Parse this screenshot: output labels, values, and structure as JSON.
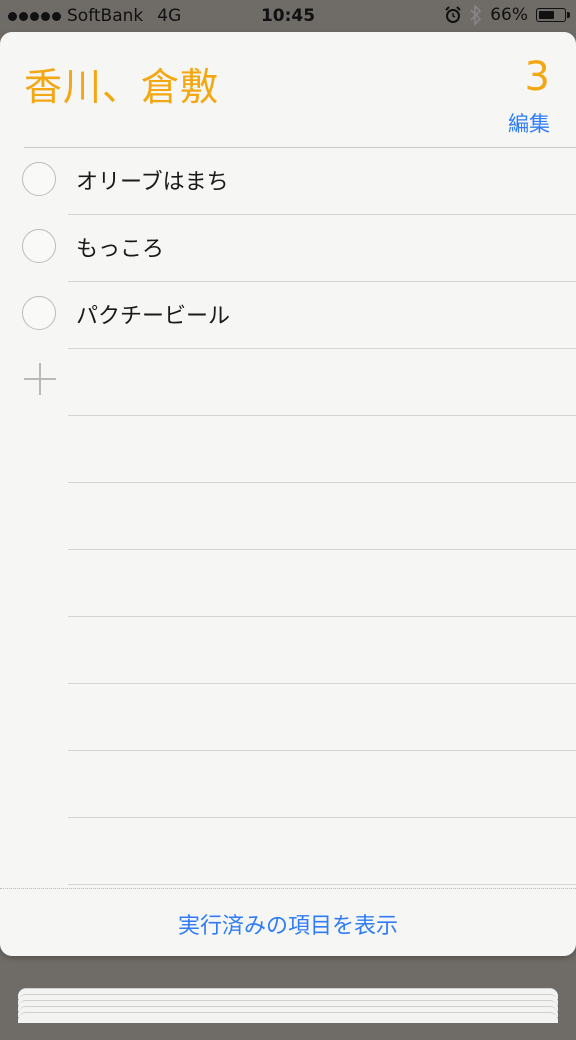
{
  "status_bar": {
    "carrier": "SoftBank",
    "network": "4G",
    "time": "10:45",
    "alarm_icon": "alarm-icon",
    "bluetooth_icon": "bluetooth-icon",
    "battery": "66%",
    "battery_level": 0.66
  },
  "list": {
    "title": "香川、倉敷",
    "count": "3",
    "edit_label": "編集",
    "items": [
      {
        "label": "オリーブはまち",
        "completed": false
      },
      {
        "label": "もっころ",
        "completed": false
      },
      {
        "label": "パクチービール",
        "completed": false
      }
    ],
    "add_icon": "plus-icon",
    "show_completed_label": "実行済みの項目を表示"
  },
  "colors": {
    "title": "#F3A712",
    "accent": "#2F7CF6",
    "background": "#F6F6F4"
  }
}
